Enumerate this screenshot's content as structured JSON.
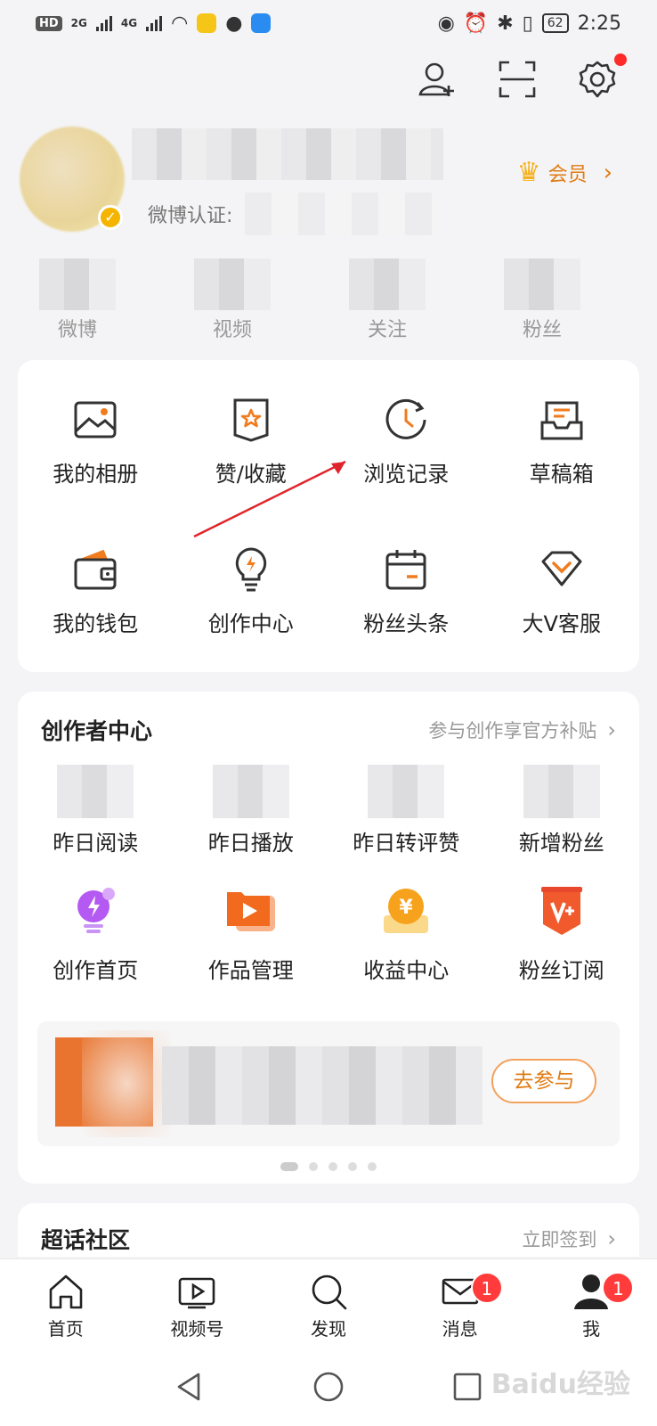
{
  "status_bar": {
    "network_badge": "HD",
    "sim": "2",
    "net1": "2G",
    "net2": "4G",
    "battery": "62",
    "time": "2:25"
  },
  "profile": {
    "verify_label": "微博认证:",
    "vip_label": "会员",
    "stats": [
      {
        "label": "微博"
      },
      {
        "label": "视频"
      },
      {
        "label": "关注"
      },
      {
        "label": "粉丝"
      }
    ]
  },
  "tools": [
    {
      "label": "我的相册",
      "icon": "album-icon"
    },
    {
      "label": "赞/收藏",
      "icon": "favorites-icon"
    },
    {
      "label": "浏览记录",
      "icon": "history-icon"
    },
    {
      "label": "草稿箱",
      "icon": "drafts-icon"
    },
    {
      "label": "我的钱包",
      "icon": "wallet-icon"
    },
    {
      "label": "创作中心",
      "icon": "bulb-icon"
    },
    {
      "label": "粉丝头条",
      "icon": "calendar-icon"
    },
    {
      "label": "大V客服",
      "icon": "diamond-icon"
    }
  ],
  "creator": {
    "title": "创作者中心",
    "more": "参与创作享官方补贴",
    "metrics": [
      {
        "label": "昨日阅读"
      },
      {
        "label": "昨日播放"
      },
      {
        "label": "昨日转评赞"
      },
      {
        "label": "新增粉丝"
      }
    ],
    "tools": [
      {
        "label": "创作首页",
        "icon": "creator-home-icon"
      },
      {
        "label": "作品管理",
        "icon": "works-icon"
      },
      {
        "label": "收益中心",
        "icon": "income-icon"
      },
      {
        "label": "粉丝订阅",
        "icon": "subscribe-icon"
      }
    ],
    "banner_button": "去参与"
  },
  "super": {
    "title": "超话社区",
    "more": "立即签到"
  },
  "tabbar": [
    {
      "label": "首页",
      "icon": "home-icon"
    },
    {
      "label": "视频号",
      "icon": "video-icon"
    },
    {
      "label": "发现",
      "icon": "search-icon"
    },
    {
      "label": "消息",
      "icon": "mail-icon",
      "badge": "1"
    },
    {
      "label": "我",
      "icon": "person-icon",
      "badge": "1"
    }
  ],
  "watermark": "Baidu经验"
}
